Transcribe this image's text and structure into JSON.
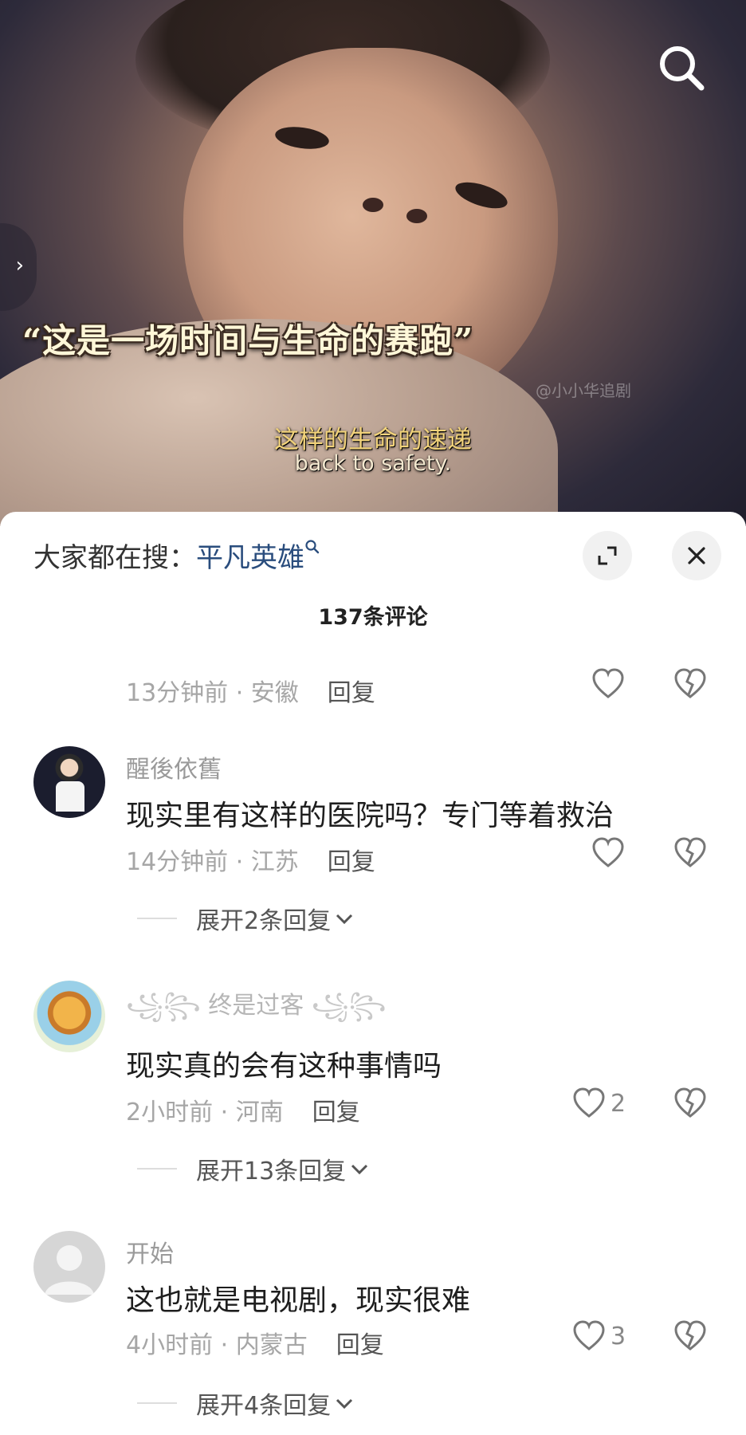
{
  "video": {
    "title_overlay": "“这是一场时间与生命的赛跑”",
    "subtitle_cn": "这样的生命的速递",
    "subtitle_en": "back to safety.",
    "watermark": "@小小华追剧"
  },
  "panel": {
    "trending_prefix": "大家都在搜：",
    "trending_keyword": "平凡英雄",
    "comment_count": "137条评论"
  },
  "comments": [
    {
      "time_loc": "13分钟前 · 安徽",
      "reply": "回复"
    },
    {
      "username": "醒後依舊",
      "text": "现实里有这样的医院吗？专门等着救治",
      "time_loc": "14分钟前 · 江苏",
      "reply": "回复",
      "expand": "展开2条回复"
    },
    {
      "username": "终是过客",
      "text": "现实真的会有这种事情吗",
      "time_loc": "2小时前 · 河南",
      "reply": "回复",
      "likes": "2",
      "expand": "展开13条回复"
    },
    {
      "username": "开始",
      "text": "这也就是电视剧，现实很难",
      "time_loc": "4小时前 · 内蒙古",
      "reply": "回复",
      "likes": "3",
      "expand": "展开4条回复"
    }
  ],
  "icons": {
    "search": "search-icon",
    "expand": "expand-icon",
    "close": "close-icon",
    "like": "heart-icon",
    "dislike": "broken-heart-icon",
    "chevron": "chevron-down-icon"
  },
  "colors": {
    "keyword": "#2a4d7d",
    "muted": "#a6a6a6",
    "subtitle": "#f1d27a"
  }
}
